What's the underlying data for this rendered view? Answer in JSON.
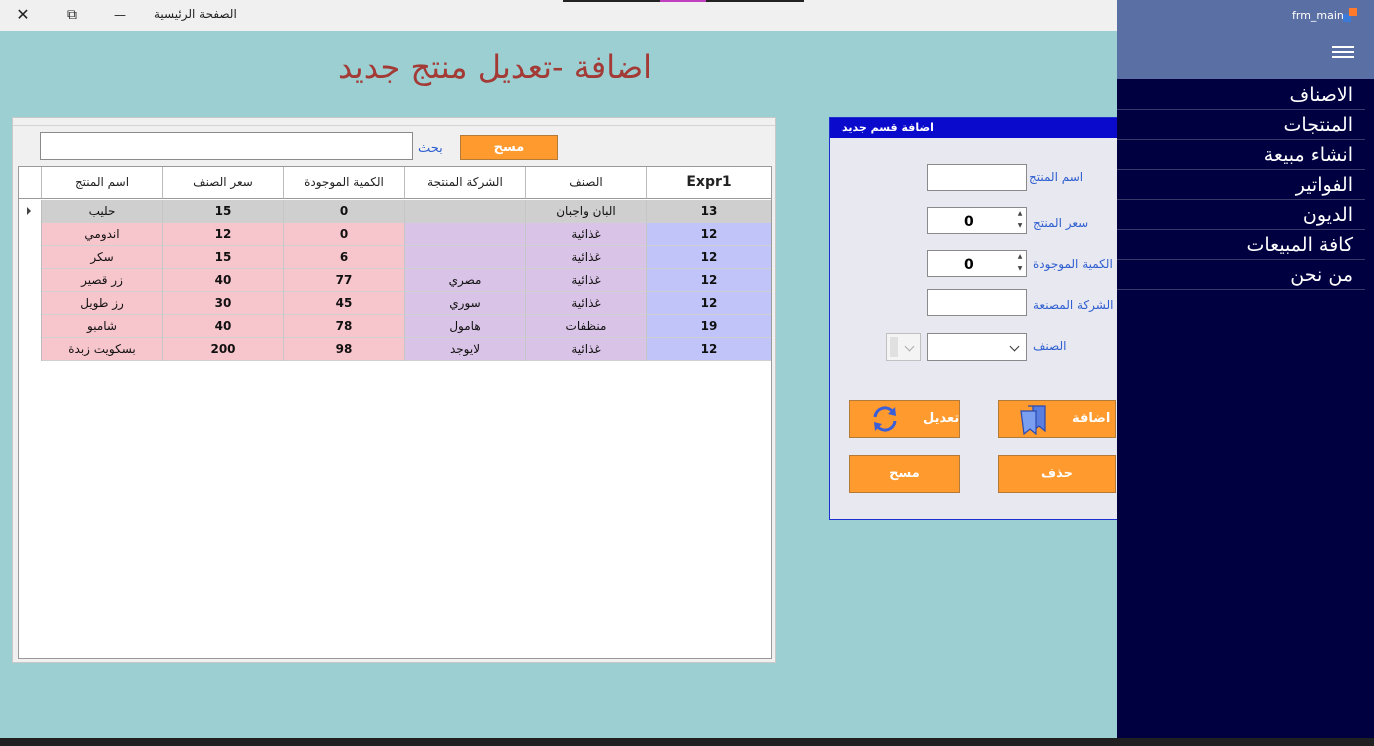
{
  "window": {
    "title": "الصفحة الرئيسية",
    "close_glyph": "✕",
    "restore_glyph": "⧉",
    "minimize_glyph": "—"
  },
  "page": {
    "heading": "اضافة -تعديل منتج جديد"
  },
  "search": {
    "label": "بحث",
    "value": "",
    "clear_label": "مسح"
  },
  "grid": {
    "columns": [
      "Expr1",
      "الصنف",
      "الشركة المنتجة",
      "الكمية الموجودة",
      "سعر الصنف",
      "اسم المنتج"
    ],
    "rows": [
      [
        "13",
        "البان واجبان",
        "",
        "0",
        "15",
        "حليب"
      ],
      [
        "12",
        "غذائية",
        "",
        "0",
        "12",
        "اندومي"
      ],
      [
        "12",
        "غذائية",
        "",
        "6",
        "15",
        "سكر"
      ],
      [
        "12",
        "غذائية",
        "مصري",
        "77",
        "40",
        "زر قصير"
      ],
      [
        "12",
        "غذائية",
        "سوري",
        "45",
        "30",
        "رز طويل"
      ],
      [
        "19",
        "منظفات",
        "هامول",
        "78",
        "40",
        "شامبو"
      ],
      [
        "12",
        "غذائية",
        "لايوجد",
        "98",
        "200",
        "بسكويت زبدة"
      ]
    ]
  },
  "form": {
    "title": "اضافة قسم جديد",
    "product_name_label": "اسم المنتج",
    "product_name_value": "",
    "price_label": "سعر المنتج",
    "price_value": "0",
    "quantity_label": "الكمية الموجودة",
    "quantity_value": "0",
    "manufacturer_label": "الشركة المصنعة",
    "manufacturer_value": "",
    "category_label": "الصنف",
    "category_value": "",
    "add_label": "اضافة",
    "edit_label": "تعديل",
    "delete_label": "حذف",
    "clear_label": "مسح"
  },
  "sidebar": {
    "app_name": "frm_main",
    "items": [
      {
        "label": "الاصناف"
      },
      {
        "label": "المنتجات"
      },
      {
        "label": "انشاء مبيعة"
      },
      {
        "label": "الفواتير"
      },
      {
        "label": "الديون"
      },
      {
        "label": "كافة المبيعات"
      },
      {
        "label": "من نحن"
      }
    ]
  },
  "colors": {
    "background": "#9ccfd1",
    "heading": "#a33a36",
    "button": "#ff9a2e",
    "sidebar": "#000040",
    "form_title": "#0a0acc"
  }
}
